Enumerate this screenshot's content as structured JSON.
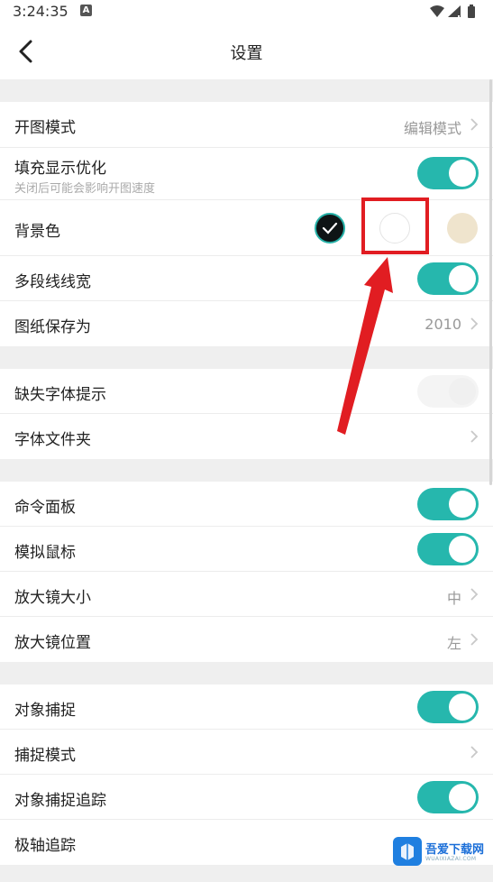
{
  "status_bar": {
    "time": "3:24:35",
    "badge": "A",
    "icons": [
      "wifi-icon",
      "signal-icon",
      "battery-icon"
    ]
  },
  "header": {
    "title": "设置",
    "back_icon": "back-arrow-icon"
  },
  "settings": {
    "open_mode": {
      "label": "开图模式",
      "value": "编辑模式"
    },
    "fill_display": {
      "label": "填充显示优化",
      "sublabel": "关闭后可能会影响开图速度",
      "enabled": true
    },
    "background_color": {
      "label": "背景色",
      "options": [
        "#0e1415",
        "#ffffff",
        "#efe4cd"
      ],
      "selected": 0
    },
    "polyline_width": {
      "label": "多段线线宽",
      "enabled": true
    },
    "save_drawing_as": {
      "label": "图纸保存为",
      "value": "2010"
    },
    "missing_font_prompt": {
      "label": "缺失字体提示",
      "enabled": false
    },
    "font_folder": {
      "label": "字体文件夹"
    },
    "command_panel": {
      "label": "命令面板",
      "enabled": true
    },
    "simulate_mouse": {
      "label": "模拟鼠标",
      "enabled": true
    },
    "magnifier_size": {
      "label": "放大镜大小",
      "value": "中"
    },
    "magnifier_position": {
      "label": "放大镜位置",
      "value": "左"
    },
    "object_snap": {
      "label": "对象捕捉",
      "enabled": true
    },
    "snap_mode": {
      "label": "捕捉模式"
    },
    "object_snap_tracking": {
      "label": "对象捕捉追踪",
      "enabled": true
    },
    "polar_tracking": {
      "label": "极轴追踪"
    }
  },
  "colors": {
    "accent": "#26b7ad",
    "annotation_red": "#e11d22",
    "section_gap": "#efefef"
  },
  "watermark": {
    "text": "吾爱下载网",
    "sub": "WUAIXIAZAI.COM"
  }
}
